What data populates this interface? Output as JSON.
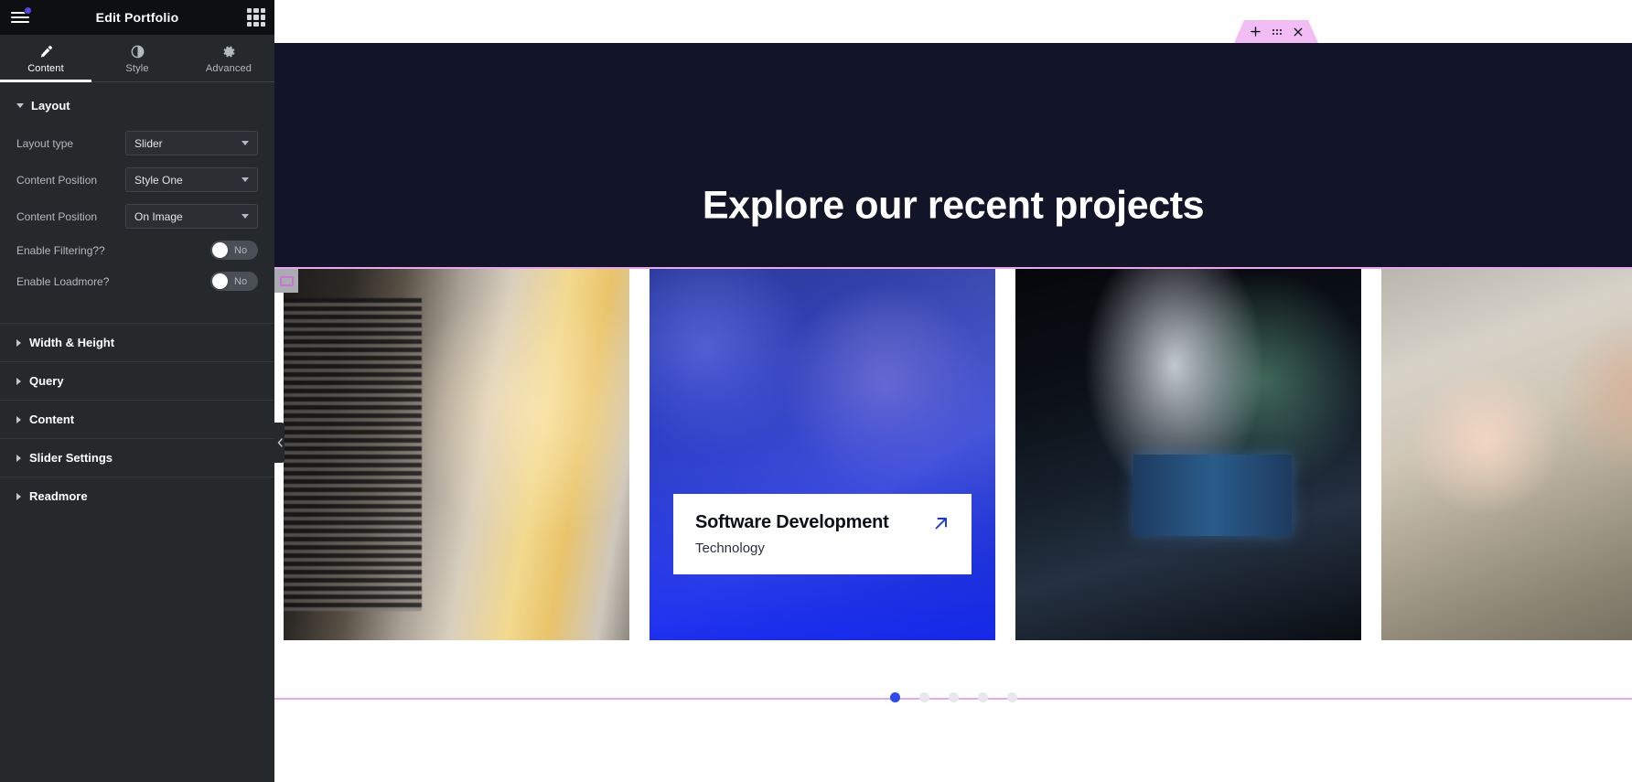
{
  "panel": {
    "header": {
      "title": "Edit Portfolio",
      "menu_icon": "hamburger-menu-icon",
      "apps_icon": "apps-grid-icon",
      "notification_dot": true
    },
    "tabs": [
      {
        "label": "Content",
        "icon": "pencil-icon",
        "active": true
      },
      {
        "label": "Style",
        "icon": "contrast-icon",
        "active": false
      },
      {
        "label": "Advanced",
        "icon": "gear-icon",
        "active": false
      }
    ],
    "layout_section": {
      "title": "Layout",
      "expanded": true,
      "controls": [
        {
          "label": "Layout type",
          "type": "select",
          "value": "Slider"
        },
        {
          "label": "Content Position",
          "type": "select",
          "value": "Style One"
        },
        {
          "label": "Content Position",
          "type": "select",
          "value": "On Image"
        },
        {
          "label": "Enable Filtering??",
          "type": "switch",
          "value": "No"
        },
        {
          "label": "Enable Loadmore?",
          "type": "switch",
          "value": "No"
        }
      ]
    },
    "collapsed_sections": [
      {
        "label": "Width & Height"
      },
      {
        "label": "Query"
      },
      {
        "label": "Content"
      },
      {
        "label": "Slider Settings"
      },
      {
        "label": "Readmore"
      }
    ],
    "collapse_handle_icon": "chevron-left-icon"
  },
  "canvas": {
    "widget_toolbar": {
      "add_icon": "plus-icon",
      "drag_icon": "drag-handle-icon",
      "close_icon": "close-icon"
    },
    "element_handle_icon": "element-box-icon",
    "hero": {
      "heading": "Explore our recent projects"
    },
    "slides": [
      {
        "image": "server-room-technician",
        "active": false,
        "title": "",
        "category": ""
      },
      {
        "image": "office-team-meeting",
        "active": true,
        "title": "Software Development",
        "category": "Technology",
        "arrow_icon": "arrow-up-right-icon"
      },
      {
        "image": "control-room-monitors",
        "active": false,
        "title": "",
        "category": ""
      },
      {
        "image": "colleagues-laptop-coffee",
        "active": false,
        "title": "",
        "category": ""
      }
    ],
    "pagination": {
      "count": 5,
      "active_index": 0
    }
  },
  "colors": {
    "panel_bg": "#26292c",
    "panel_header_bg": "#0e0f12",
    "accent_blue": "#2b4bf2",
    "notification_purple": "#5145ed",
    "selection_pink": "#e8a6ef",
    "toolbar_pink": "#f2bdf5",
    "hero_bg": "#121427"
  }
}
